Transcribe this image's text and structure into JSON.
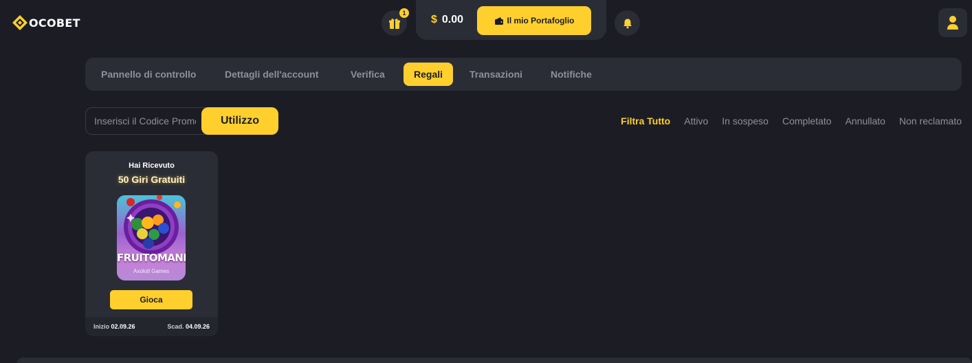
{
  "brand": {
    "logo_text": "OCOBET"
  },
  "header": {
    "gift_badge_count": "1",
    "balance_currency": "$",
    "balance_amount": "0.00",
    "wallet_button_label": "Il mio Portafoglio"
  },
  "tabs": [
    {
      "label": "Pannello di controllo",
      "active": false
    },
    {
      "label": "Dettagli dell'account",
      "active": false
    },
    {
      "label": "Verifica",
      "active": false
    },
    {
      "label": "Regali",
      "active": true
    },
    {
      "label": "Transazioni",
      "active": false
    },
    {
      "label": "Notifiche",
      "active": false
    }
  ],
  "promo": {
    "placeholder": "Inserisci il Codice Promo",
    "button_label": "Utilizzo"
  },
  "filters": [
    {
      "label": "Filtra Tutto",
      "active": true
    },
    {
      "label": "Attivo",
      "active": false
    },
    {
      "label": "In sospeso",
      "active": false
    },
    {
      "label": "Completato",
      "active": false
    },
    {
      "label": "Annullato",
      "active": false
    },
    {
      "label": "Non reclamato",
      "active": false
    }
  ],
  "gift_card": {
    "received_label": "Hai Ricevuto",
    "prize": "50 Giri Gratuiti",
    "game_title": "FRUITOMANIA",
    "game_provider": "Axolotl Games",
    "play_label": "Gioca",
    "start_label": "Inizio",
    "start_date": "02.09.26",
    "expiry_label": "Scad.",
    "expiry_date": "04.09.26"
  },
  "colors": {
    "accent": "#ffcf2e",
    "background": "#1c1d24",
    "panel": "#2b2d36",
    "muted_text": "#8d909b"
  }
}
